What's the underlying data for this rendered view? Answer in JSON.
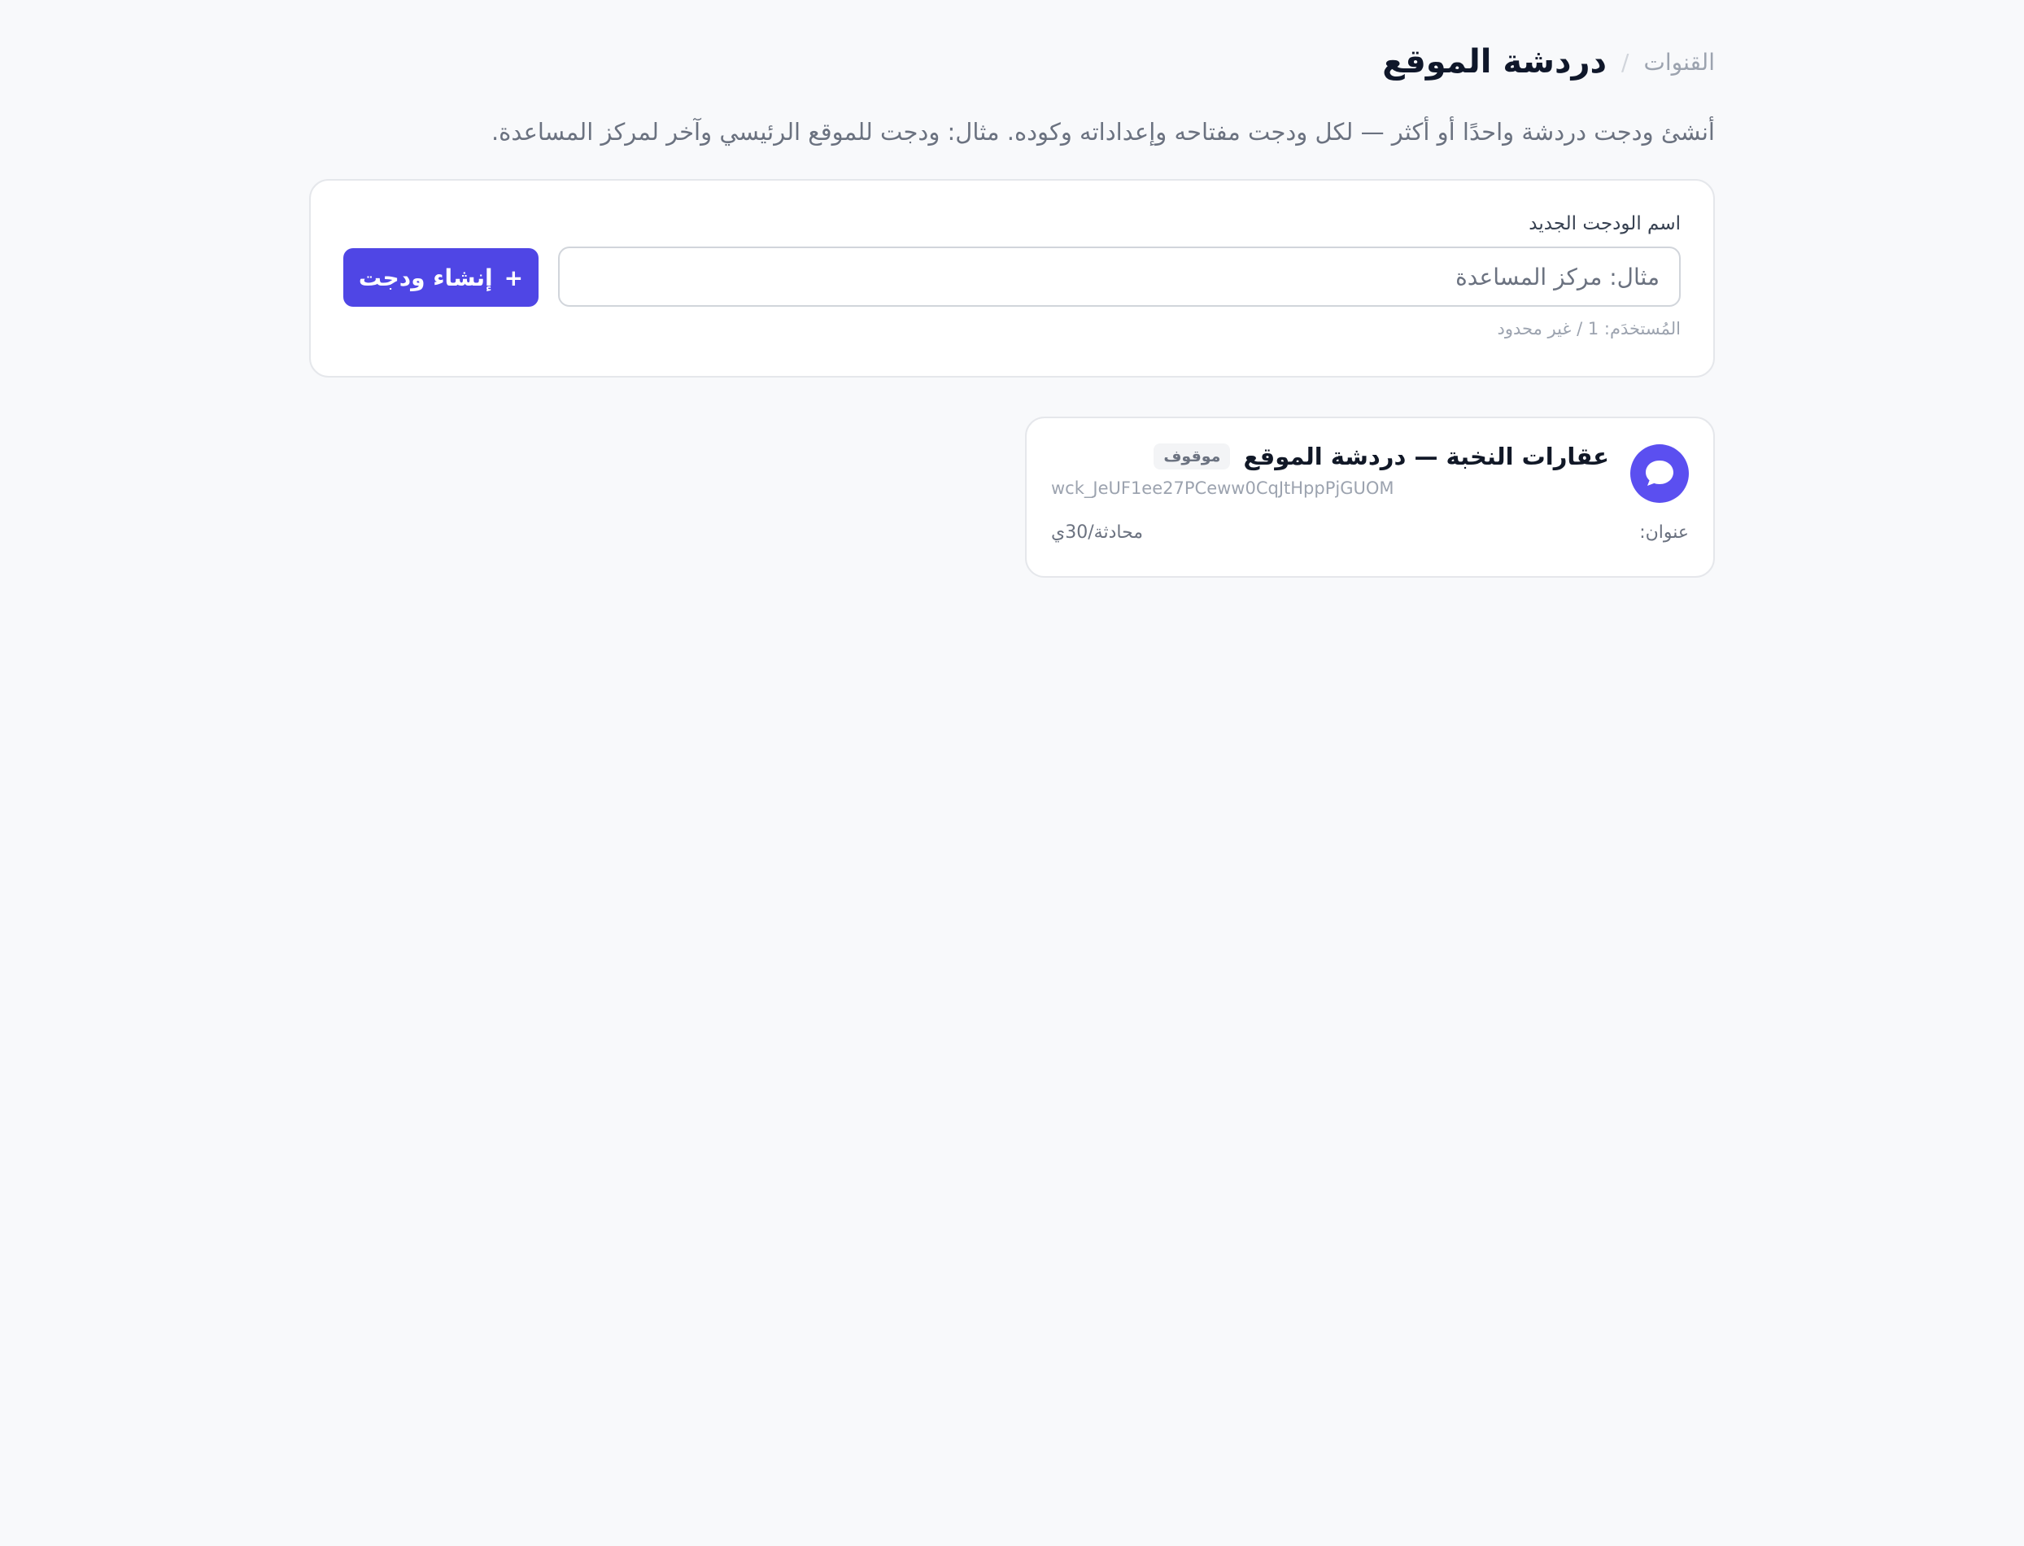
{
  "breadcrumb": {
    "parent": "القنوات",
    "separator": "/",
    "current": "دردشة الموقع"
  },
  "description": "أنشئ ودجت دردشة واحدًا أو أكثر — لكل ودجت مفتاحه وإعداداته وكوده. مثال: ودجت للموقع الرئيسي وآخر لمركز المساعدة.",
  "create_form": {
    "label": "اسم الودجت الجديد",
    "input_value": "",
    "placeholder": "مثال: مركز المساعدة",
    "button_icon": "+",
    "button_label": "إنشاء ودجت",
    "usage": "المُستخدَم: 1 / غير محدود"
  },
  "widgets": [
    {
      "icon": "chat-bubble-icon",
      "title": "عقارات النخبة — دردشة الموقع",
      "status": "موقوف",
      "key": "wck_JeUF1ee27PCeww0CqJtHppPjGUOM",
      "address_label": "عنوان:",
      "stats": "محادثة/30ي"
    }
  ],
  "colors": {
    "background": "#f8f9fb",
    "accent": "#4f46e5",
    "avatar": "#5b4ff0",
    "card_border": "#e5e7eb",
    "muted_text": "#9ca3af"
  }
}
